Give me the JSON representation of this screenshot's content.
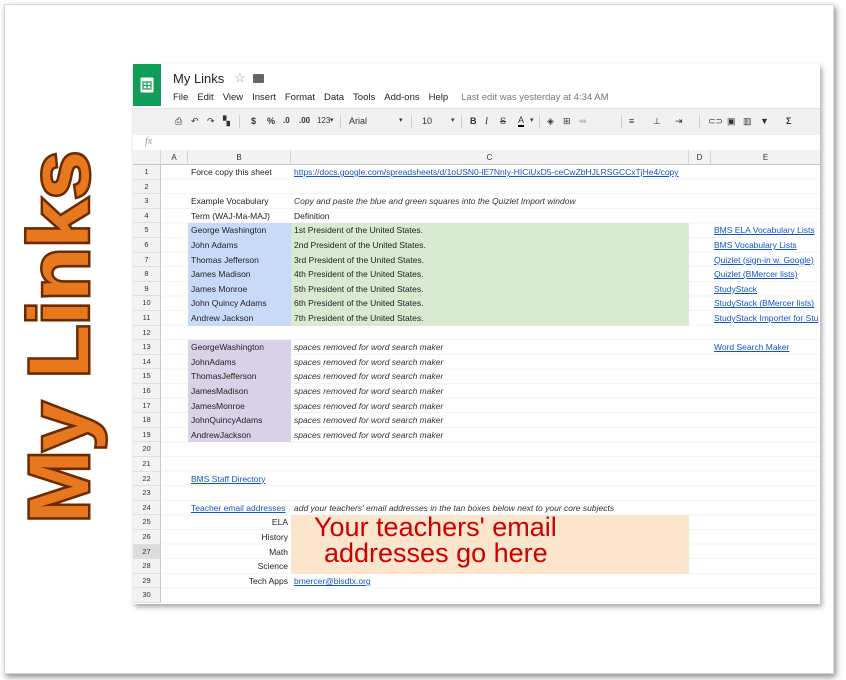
{
  "side_title": "My Links",
  "app": {
    "title": "My Links",
    "menu": [
      "File",
      "Edit",
      "View",
      "Insert",
      "Format",
      "Data",
      "Tools",
      "Add-ons",
      "Help"
    ],
    "last_edit": "Last edit was yesterday at 4:34 AM"
  },
  "toolbar": {
    "currency": "$",
    "percent": "%",
    "dec_less": ".0",
    "dec_more": ".00",
    "number_format": "123",
    "font": "Arial",
    "font_size": "10",
    "bold": "B",
    "italic": "I",
    "strike": "S",
    "text_color": "A",
    "sigma": "Σ"
  },
  "formula_bar": {
    "fx": "fx",
    "value": ""
  },
  "columns": [
    "A",
    "B",
    "C",
    "D",
    "E"
  ],
  "rows": [
    "1",
    "2",
    "3",
    "4",
    "5",
    "6",
    "7",
    "8",
    "9",
    "10",
    "11",
    "12",
    "13",
    "14",
    "15",
    "16",
    "17",
    "18",
    "19",
    "20",
    "21",
    "22",
    "23",
    "24",
    "25",
    "26",
    "27",
    "28",
    "29",
    "30"
  ],
  "cells": {
    "r1b": "Force copy this sheet",
    "r1c": "https://docs.google.com/spreadsheets/d/1oUSN0-lE7Nnly-HICiUxD5-ceCwZbHJLRSGCCxTjHe4/copy",
    "r3b": "Example Vocabulary",
    "r3c": "Copy and paste the blue and green squares into the Quizlet Import window",
    "r4b": "Term (WAJ-Ma-MAJ)",
    "r4c": "Definition",
    "terms": [
      "George Washington",
      "John Adams",
      "Thomas Jefferson",
      "James Madison",
      "James Monroe",
      "John Quincy Adams",
      "Andrew Jackson"
    ],
    "definitions": [
      "1st President of the United States.",
      "2nd President of the United States.",
      "3rd President of the United States.",
      "4th President of the United States.",
      "5th President of the United States.",
      "6th President of the United States.",
      "7th President of the United States."
    ],
    "links_e": [
      "BMS ELA Vocabulary Lists",
      "BMS Vocabulary Lists",
      "Quizlet (sign-in w. Google)",
      "Quizlet (BMercer lists)",
      "StudyStack",
      "StudyStack (BMercer lists)",
      "StudyStack Importer for Stu"
    ],
    "nospace_terms": [
      "GeorgeWashington",
      "JohnAdams",
      "ThomasJefferson",
      "JamesMadison",
      "JamesMonroe",
      "JohnQuincyAdams",
      "AndrewJackson"
    ],
    "nospace_note": "spaces removed for word search maker",
    "word_search": "Word Search Maker",
    "r22b": "BMS Staff Directory",
    "r24b": "Teacher email addresses",
    "r24c": "add your teachers' email addresses in the tan boxes below next to your core subjects",
    "subjects": [
      "ELA",
      "History",
      "Math",
      "Science"
    ],
    "r29b": "Tech Apps",
    "r29c": "bmercer@bisdtx.org",
    "overlay_line1": "Your teachers' email",
    "overlay_line2": "addresses go here"
  },
  "colors": {
    "logo": "#0f9d58",
    "blue": "#c9daf8",
    "green": "#d9ead3",
    "purple": "#d9d2e9",
    "tan": "#fce5cd",
    "side_title_fill": "#e8781e",
    "overlay_text": "#cc0000"
  }
}
